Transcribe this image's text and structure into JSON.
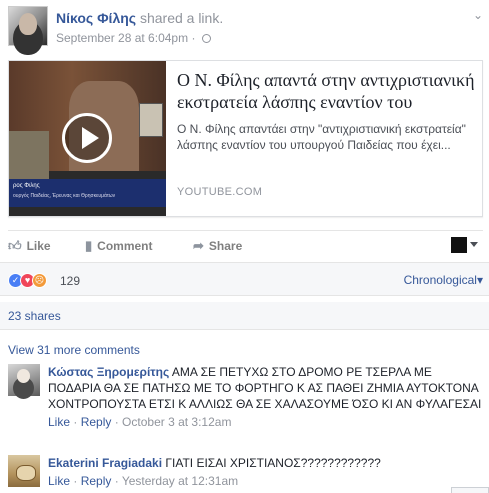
{
  "post": {
    "author": "Νίκος Φίλης",
    "action": "shared a link.",
    "timestamp": "September 28 at 6:04pm",
    "separator": "·",
    "privacy_icon": "globe-icon",
    "options_icon": "chevron-down-icon"
  },
  "link": {
    "title": "Ο Ν. Φίλης απαντά στην αντιχριστιανική εκστρατεία λάσπης εναντίον του",
    "description": "Ο Ν. Φίλης απαντάει στην \"αντιχριστιανική εκστρατεία\" λάσπης εναντίον του υπουργού Παιδείας που έχει...",
    "domain": "YOUTUBE.COM",
    "thumb_caption_1": "ρος Φιλης",
    "thumb_caption_2": "ουργός Παιδείας, Έρευνας και Θρησκευμάτων"
  },
  "actions": {
    "like": "Like",
    "comment": "Comment",
    "share": "Share"
  },
  "reactions": {
    "count": "129",
    "types": [
      "like",
      "love",
      "angry"
    ],
    "order_label": "Chronological",
    "order_caret": "▾"
  },
  "shares": "23 shares",
  "view_more": "View 31 more comments",
  "comments": [
    {
      "name": "Κώστας Ξηρομερίτης",
      "text": "ΑΜΑ ΣΕ ΠΕΤΥΧΩ ΣΤΟ ΔΡΟΜΟ ΡΕ ΤΣΕΡΛΑ ΜΕ ΠΟΔΑΡΙΑ ΘΑ ΣΕ ΠΑΤΗΣΩ ΜΕ ΤΟ ΦΟΡΤΗΓΟ Κ ΑΣ ΠΑΘΕΙ ΖΗΜΙΑ ΑΥΤΟΚΤΟΝΑ ΧΟΝΤΡΟΠΟΥΣΤΑ ΕΤΣΙ Κ ΑΛΛΙΩΣ ΘΑ ΣΕ ΧΑΛΑΣΟΥΜΕ ΌΣΟ ΚΙ ΑΝ ΦΥΛΑΓΕΣΑΙ",
      "like": "Like",
      "reply": "Reply",
      "time": "October 3 at 3:12am"
    },
    {
      "name": "Ekaterini Fragiadaki",
      "text": "ΓΙΑΤΙ ΕΙΣΑΙ ΧΡΙΣΤΙΑΝΟΣ????????????",
      "like": "Like",
      "reply": "Reply",
      "time": "Yesterday at 12:31am"
    }
  ],
  "colors": {
    "link": "#365899",
    "muted": "#90949c",
    "like_reaction": "#4a7ff5",
    "love_reaction": "#f0465a",
    "angry_reaction": "#f39a3a"
  }
}
